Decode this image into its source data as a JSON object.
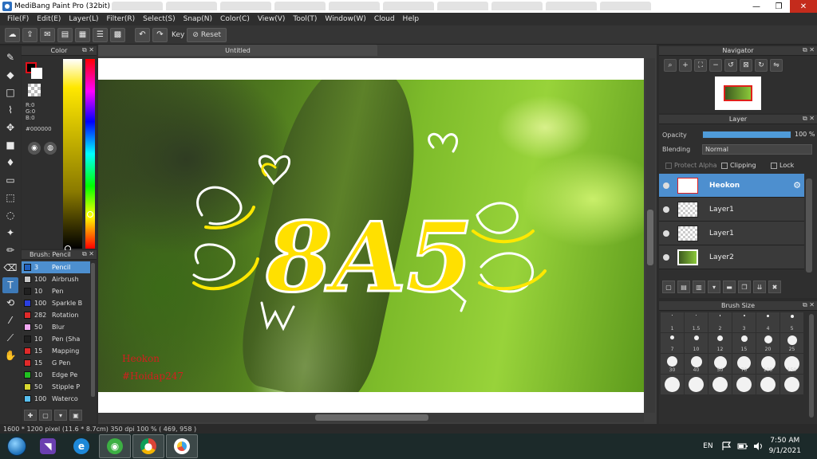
{
  "window": {
    "title": "MediBang Paint Pro (32bit)",
    "controls": {
      "minimize": "—",
      "maximize": "❐",
      "close": "✕"
    }
  },
  "menu": [
    "File(F)",
    "Edit(E)",
    "Layer(L)",
    "Filter(R)",
    "Select(S)",
    "Snap(N)",
    "Color(C)",
    "View(V)",
    "Tool(T)",
    "Window(W)",
    "Cloud",
    "Help"
  ],
  "toolbar": {
    "key_label": "Key",
    "reset_label": "Reset"
  },
  "color_panel": {
    "title": "Color",
    "r": "R:0",
    "g": "G:0",
    "b": "B:0",
    "hex": "#000000",
    "foreground": "#000000",
    "background": "#ffffff"
  },
  "brush_panel": {
    "title": "Brush: Pencil",
    "items": [
      {
        "size": "3",
        "name": "Pencil",
        "color": "#2060c0",
        "selected": true
      },
      {
        "size": "100",
        "name": "Airbrush",
        "color": "#c8c8c8"
      },
      {
        "size": "10",
        "name": "Pen",
        "color": "#202020"
      },
      {
        "size": "100",
        "name": "Sparkle B",
        "color": "#2a3fe0"
      },
      {
        "size": "282",
        "name": "Rotation",
        "color": "#e02a2a"
      },
      {
        "size": "50",
        "name": "Blur",
        "color": "#f0a8f0"
      },
      {
        "size": "10",
        "name": "Pen (Sha",
        "color": "#202020"
      },
      {
        "size": "15",
        "name": "Mapping",
        "color": "#e02a2a"
      },
      {
        "size": "15",
        "name": "G Pen",
        "color": "#e02a2a"
      },
      {
        "size": "10",
        "name": "Edge Pe",
        "color": "#20c020"
      },
      {
        "size": "50",
        "name": "Stipple P",
        "color": "#d8d830"
      },
      {
        "size": "100",
        "name": "Waterco",
        "color": "#58c0f0"
      }
    ]
  },
  "canvas": {
    "tab_title": "Untitled",
    "watermark_line1": "Heokon",
    "watermark_line2": "#Hoidap247",
    "artwork_text": "8A5"
  },
  "navigator": {
    "title": "Navigator"
  },
  "layer_panel": {
    "title": "Layer",
    "opacity_label": "Opacity",
    "opacity_value": "100 %",
    "opacity_percent": 100,
    "blending_label": "Blending",
    "blending_value": "Normal",
    "protect_alpha": "Protect Alpha",
    "clipping": "Clipping",
    "lock": "Lock",
    "layers": [
      {
        "name": "Heokon",
        "selected": true
      },
      {
        "name": "Layer1"
      },
      {
        "name": "Layer1"
      },
      {
        "name": "Layer2"
      }
    ]
  },
  "brush_size_panel": {
    "title": "Brush Size",
    "sizes": [
      "1",
      "1.5",
      "2",
      "3",
      "4",
      "5",
      "7",
      "10",
      "12",
      "15",
      "20",
      "25",
      "30",
      "40",
      "50",
      "70",
      "100",
      "150",
      "",
      "",
      "",
      "",
      "",
      ""
    ]
  },
  "status": {
    "text": "1600 * 1200 pixel  (11.6 * 8.7cm)  350 dpi  100 %  ( 469, 958 )"
  },
  "taskbar": {
    "lang": "EN",
    "time": "7:50 AM",
    "date": "9/1/2021"
  }
}
